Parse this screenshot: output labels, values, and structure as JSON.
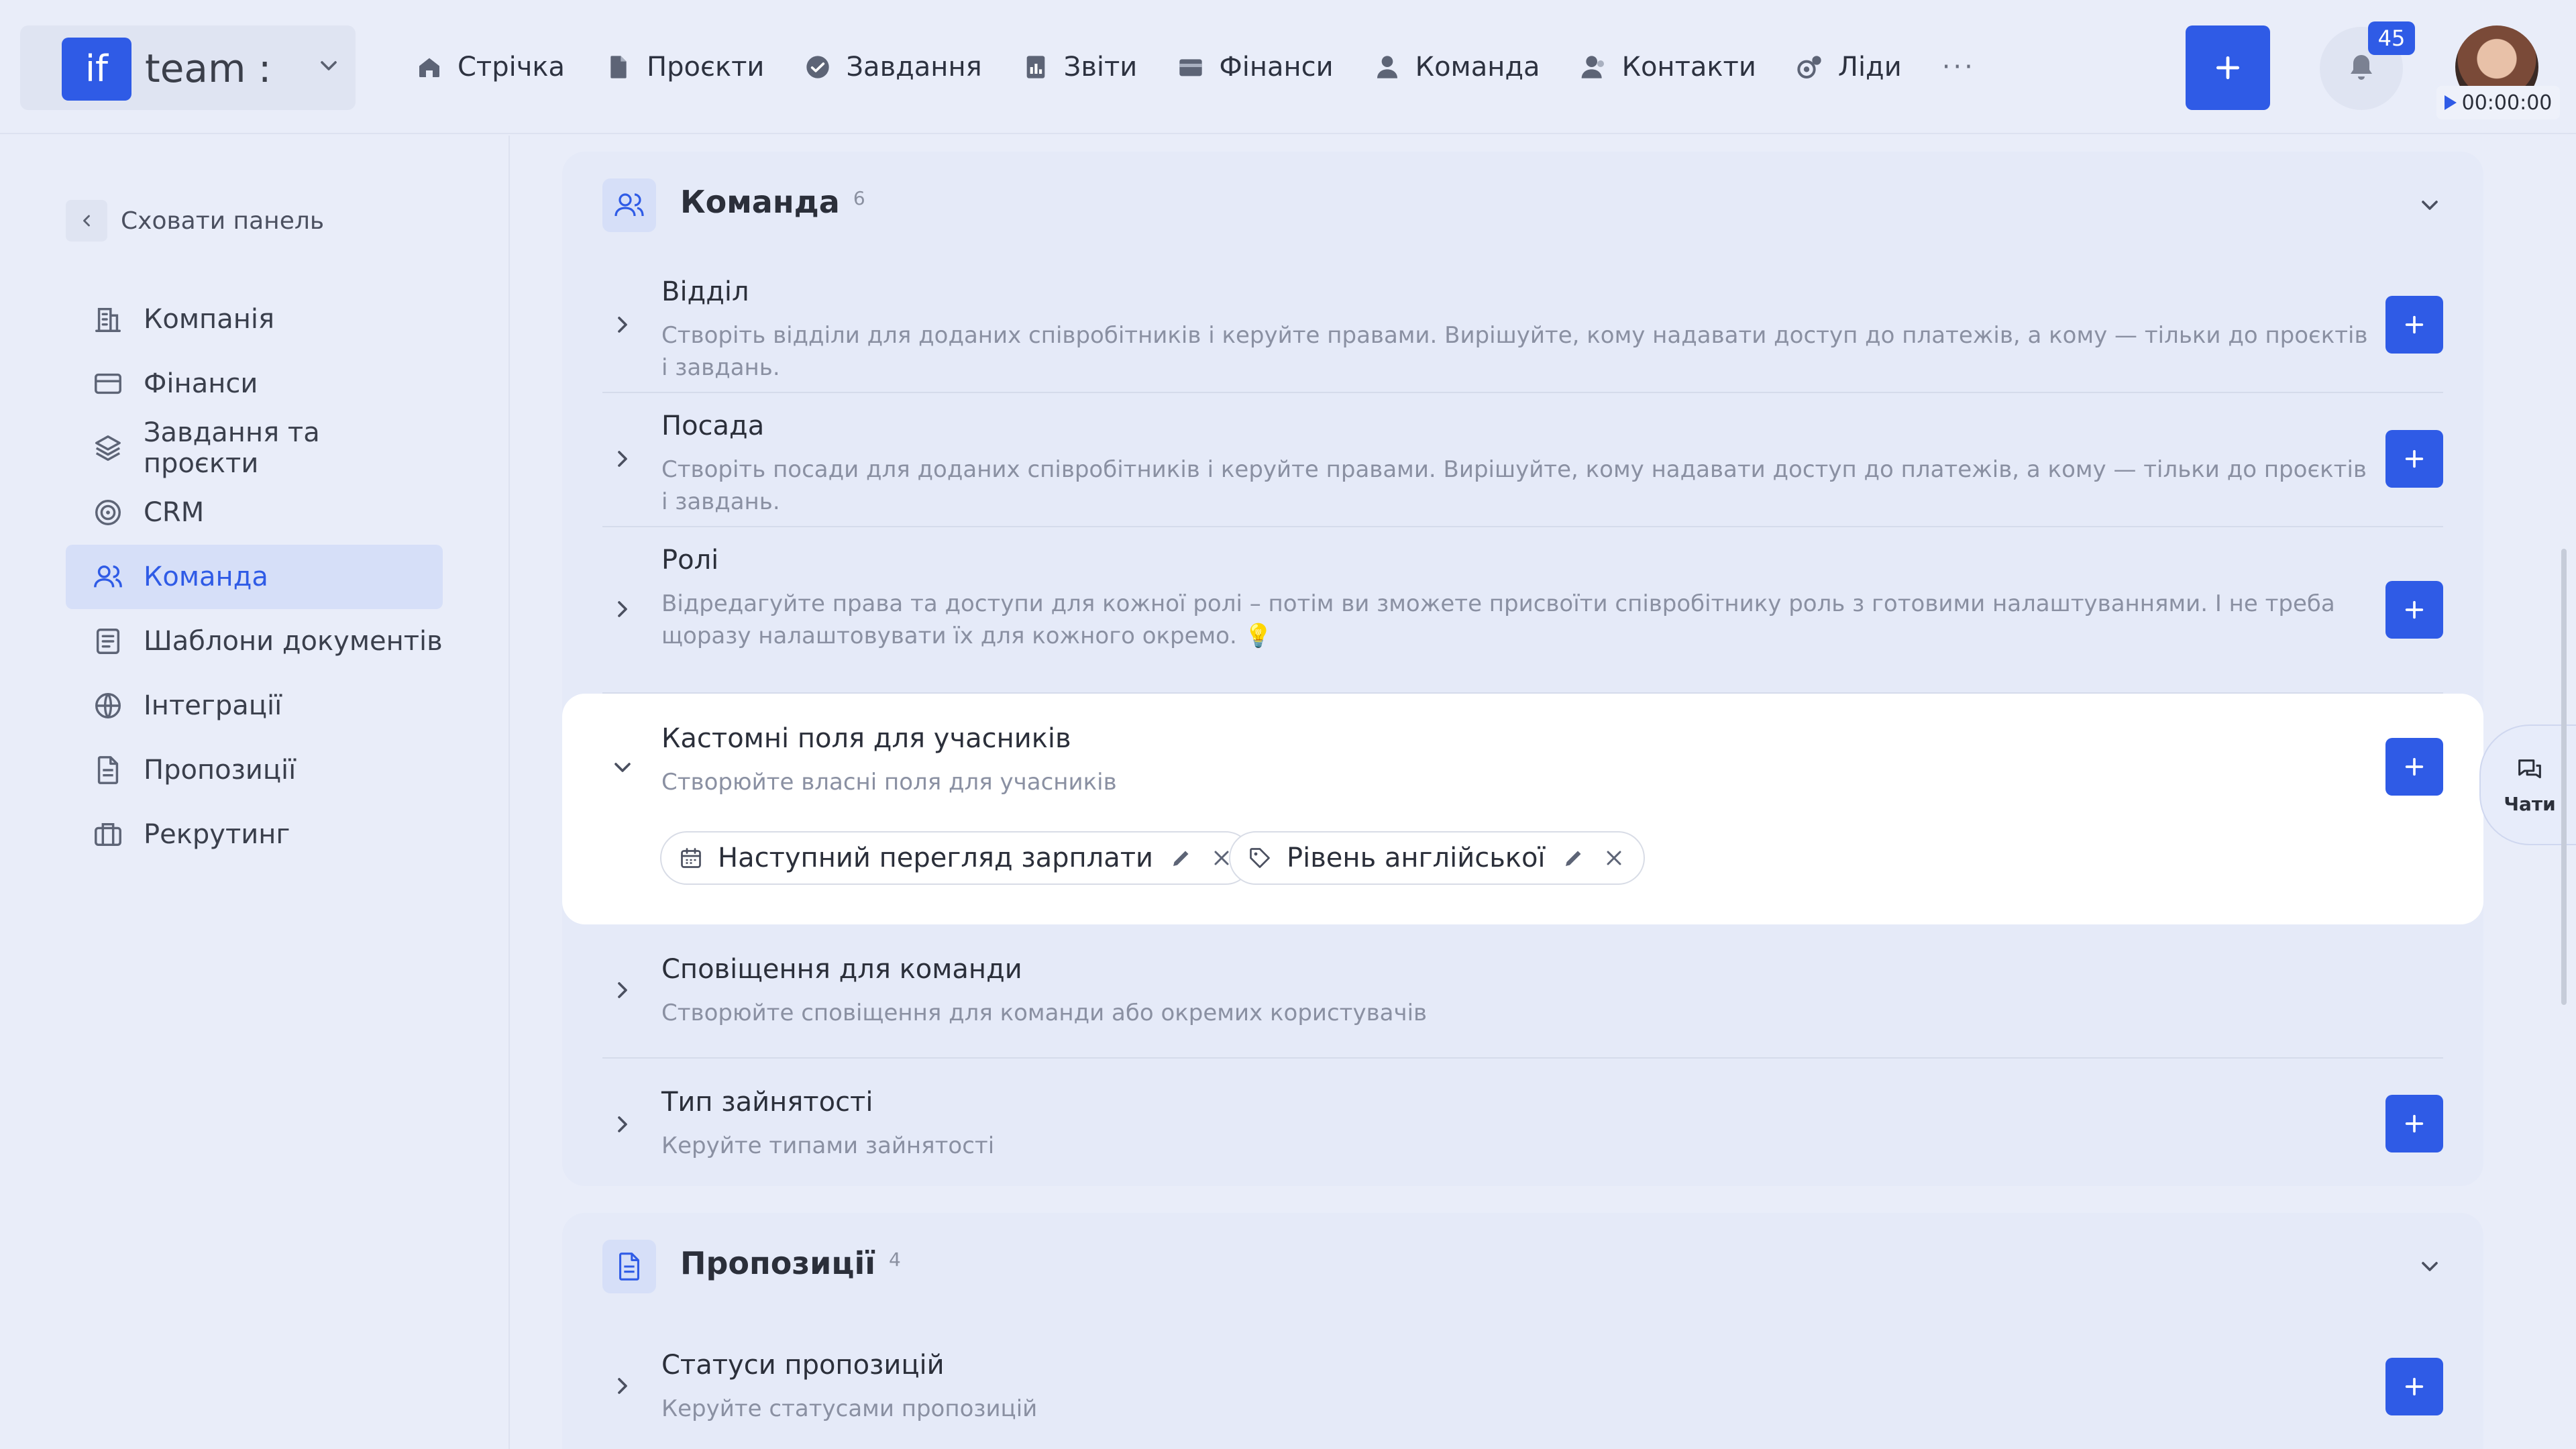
{
  "brand": {
    "logo_text": "if",
    "name": "team :"
  },
  "nav": [
    {
      "label": "Стрічка",
      "icon": "home-icon"
    },
    {
      "label": "Проєкти",
      "icon": "document-icon"
    },
    {
      "label": "Завдання",
      "icon": "check-circle-icon"
    },
    {
      "label": "Звіти",
      "icon": "report-icon"
    },
    {
      "label": "Фінанси",
      "icon": "wallet-icon"
    },
    {
      "label": "Команда",
      "icon": "user-icon"
    },
    {
      "label": "Контакти",
      "icon": "contacts-icon"
    },
    {
      "label": "Ліди",
      "icon": "leads-icon"
    }
  ],
  "nav_more": "···",
  "notifications": {
    "count": "45"
  },
  "timer": {
    "value": "00:00:00"
  },
  "sidebar": {
    "hide_label": "Сховати панель",
    "items": [
      {
        "label": "Компанія",
        "icon": "company-icon"
      },
      {
        "label": "Фінанси",
        "icon": "card-icon"
      },
      {
        "label": "Завдання та проєкти",
        "icon": "layers-icon"
      },
      {
        "label": "CRM",
        "icon": "target-icon"
      },
      {
        "label": "Команда",
        "icon": "users-icon",
        "active": true
      },
      {
        "label": "Шаблони документів",
        "icon": "template-icon"
      },
      {
        "label": "Інтеграції",
        "icon": "globe-icon"
      },
      {
        "label": "Пропозиції",
        "icon": "file-icon"
      },
      {
        "label": "Рекрутинг",
        "icon": "briefcase-icon"
      }
    ]
  },
  "team_card": {
    "title": "Команда",
    "count": "6",
    "rows": [
      {
        "title": "Відділ",
        "desc": "Створіть відділи для доданих співробітників і керуйте правами. Вирішуйте, кому надавати доступ до платежів, а кому — тільки до проєктів і завдань."
      },
      {
        "title": "Посада",
        "desc": "Створіть посади для доданих співробітників і керуйте правами. Вирішуйте, кому надавати доступ до платежів, а кому — тільки до проєктів і завдань."
      },
      {
        "title": "Ролі",
        "desc": "Відредагуйте права та доступи для кожної ролі – потім ви зможете присвоїти співробітнику роль з готовими налаштуваннями. І не треба щоразу налаштовувати їх для кожного окремо. 💡"
      },
      {
        "title": "Кастомні поля для учасників",
        "desc": "Створюйте власні поля для учасників",
        "chips": [
          {
            "label": "Наступний перегляд зарплати",
            "icon": "calendar-icon"
          },
          {
            "label": "Рівень англійської",
            "icon": "tag-icon"
          }
        ]
      },
      {
        "title": "Сповіщення для команди",
        "desc": "Створюйте сповіщення для команди або окремих користувачів"
      },
      {
        "title": "Тип зайнятості",
        "desc": "Керуйте типами зайнятості"
      }
    ]
  },
  "proposals_card": {
    "title": "Пропозиції",
    "count": "4",
    "rows": [
      {
        "title": "Статуси пропозицій",
        "desc": "Керуйте статусами пропозицій"
      }
    ]
  },
  "chats": {
    "label": "Чати"
  }
}
